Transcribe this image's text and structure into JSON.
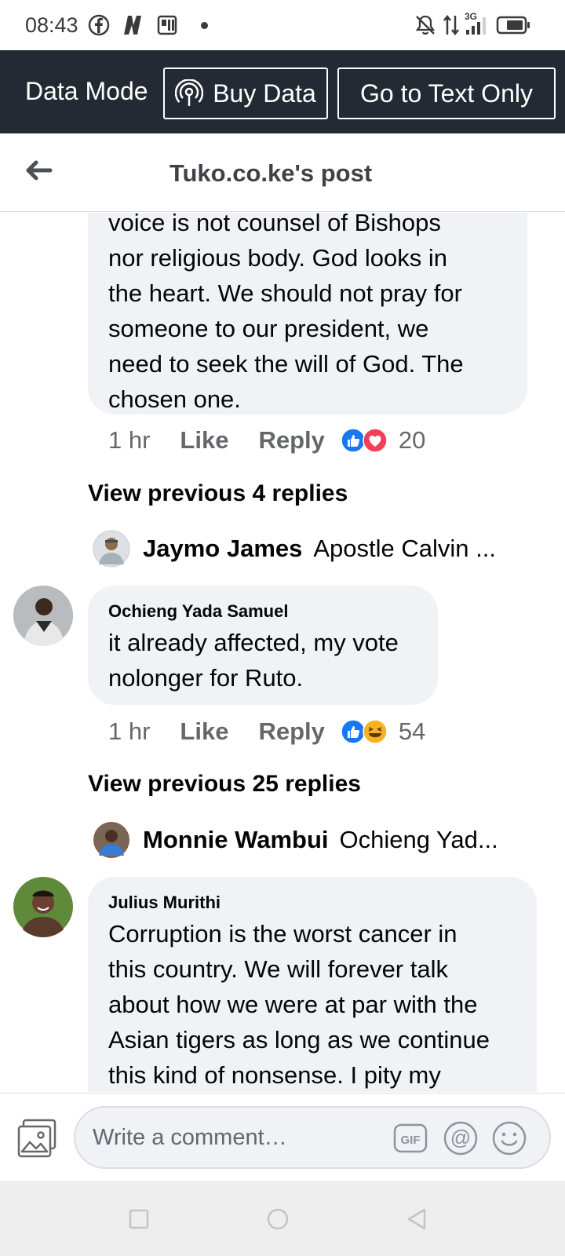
{
  "status_bar": {
    "time": "08:43",
    "network": "3G"
  },
  "data_bar": {
    "mode_label": "Data Mode",
    "buy_data_label": "Buy Data",
    "text_only_label": "Go to Text Only"
  },
  "header": {
    "title": "Tuko.co.ke's post"
  },
  "comment1": {
    "text_lines": [
      "voice  is  not counsel of Bishops",
      "nor religious  body.  God looks  in",
      "the heart. We should  not pray  for",
      "someone  to our president,  we",
      "need  to seek  the will of God. The",
      "chosen  one."
    ],
    "time": "1 hr",
    "like_label": "Like",
    "reply_label": "Reply",
    "reaction_count": "20",
    "view_previous": "View previous 4 replies",
    "reply_author": "Jaymo James",
    "reply_text": "Apostle Calvin ..."
  },
  "comment2": {
    "author": "Ochieng Yada Samuel",
    "text_lines": [
      "it already affected, my vote",
      "nolonger for Ruto."
    ],
    "time": "1 hr",
    "like_label": "Like",
    "reply_label": "Reply",
    "reaction_count": "54",
    "view_previous": "View previous 25 replies",
    "reply_author": "Monnie Wambui",
    "reply_text": "Ochieng Yad..."
  },
  "comment3": {
    "author": "Julius Murithi",
    "text_lines": [
      "Corruption is the worst cancer in",
      "this country. We will forever talk",
      "about how we were at par with the",
      "Asian tigers as long as we continue",
      "this kind of nonsense. I pity my"
    ]
  },
  "composer": {
    "placeholder": "Write a comment…",
    "gif_label": "GIF",
    "mention_label": "@"
  },
  "colors": {
    "data_bar_bg": "#242a33",
    "bubble_bg": "#f0f2f5",
    "like_blue": "#1877f2",
    "love_red": "#f33e58",
    "haha_yellow": "#f7b125"
  },
  "icons": [
    "facebook-icon",
    "netflix-icon",
    "news-icon",
    "mute-icon",
    "signal-icon",
    "battery-icon",
    "back-arrow-icon",
    "photo-icon",
    "gif-icon",
    "mention-icon",
    "emoji-icon",
    "like-reaction-icon",
    "love-reaction-icon",
    "haha-reaction-icon"
  ]
}
